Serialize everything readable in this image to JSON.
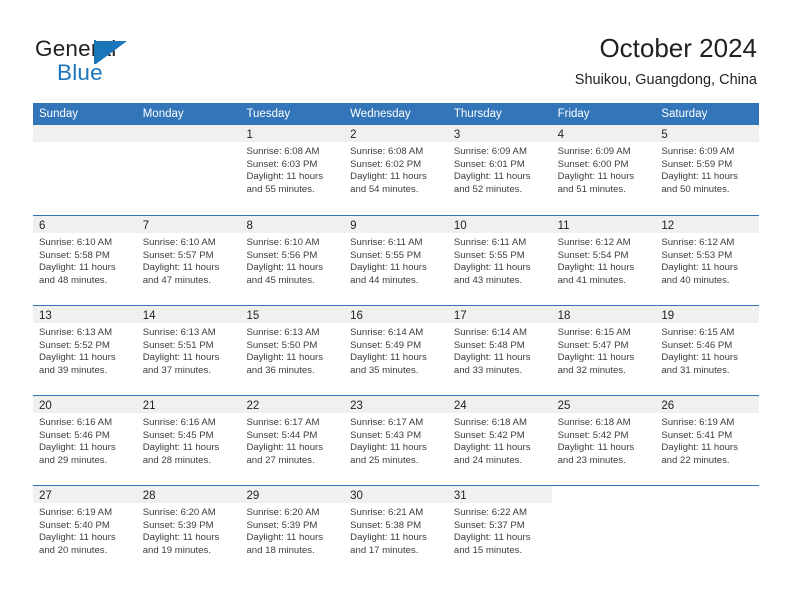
{
  "logo": {
    "word_top": "General",
    "word_bottom": "Blue",
    "accent_color": "#1b75bb"
  },
  "header": {
    "title": "October 2024",
    "subtitle": "Shuikou, Guangdong, China"
  },
  "theme": {
    "header_blue": "#3275b8",
    "day_band_gray": "#f0f0f0",
    "text_color": "#231f20"
  },
  "weekdays": [
    "Sunday",
    "Monday",
    "Tuesday",
    "Wednesday",
    "Thursday",
    "Friday",
    "Saturday"
  ],
  "weeks": [
    [
      {
        "day": "",
        "empty": true
      },
      {
        "day": "",
        "empty": true
      },
      {
        "day": "1",
        "sunrise": "Sunrise: 6:08 AM",
        "sunset": "Sunset: 6:03 PM",
        "daylight1": "Daylight: 11 hours",
        "daylight2": "and 55 minutes."
      },
      {
        "day": "2",
        "sunrise": "Sunrise: 6:08 AM",
        "sunset": "Sunset: 6:02 PM",
        "daylight1": "Daylight: 11 hours",
        "daylight2": "and 54 minutes."
      },
      {
        "day": "3",
        "sunrise": "Sunrise: 6:09 AM",
        "sunset": "Sunset: 6:01 PM",
        "daylight1": "Daylight: 11 hours",
        "daylight2": "and 52 minutes."
      },
      {
        "day": "4",
        "sunrise": "Sunrise: 6:09 AM",
        "sunset": "Sunset: 6:00 PM",
        "daylight1": "Daylight: 11 hours",
        "daylight2": "and 51 minutes."
      },
      {
        "day": "5",
        "sunrise": "Sunrise: 6:09 AM",
        "sunset": "Sunset: 5:59 PM",
        "daylight1": "Daylight: 11 hours",
        "daylight2": "and 50 minutes."
      }
    ],
    [
      {
        "day": "6",
        "sunrise": "Sunrise: 6:10 AM",
        "sunset": "Sunset: 5:58 PM",
        "daylight1": "Daylight: 11 hours",
        "daylight2": "and 48 minutes."
      },
      {
        "day": "7",
        "sunrise": "Sunrise: 6:10 AM",
        "sunset": "Sunset: 5:57 PM",
        "daylight1": "Daylight: 11 hours",
        "daylight2": "and 47 minutes."
      },
      {
        "day": "8",
        "sunrise": "Sunrise: 6:10 AM",
        "sunset": "Sunset: 5:56 PM",
        "daylight1": "Daylight: 11 hours",
        "daylight2": "and 45 minutes."
      },
      {
        "day": "9",
        "sunrise": "Sunrise: 6:11 AM",
        "sunset": "Sunset: 5:55 PM",
        "daylight1": "Daylight: 11 hours",
        "daylight2": "and 44 minutes."
      },
      {
        "day": "10",
        "sunrise": "Sunrise: 6:11 AM",
        "sunset": "Sunset: 5:55 PM",
        "daylight1": "Daylight: 11 hours",
        "daylight2": "and 43 minutes."
      },
      {
        "day": "11",
        "sunrise": "Sunrise: 6:12 AM",
        "sunset": "Sunset: 5:54 PM",
        "daylight1": "Daylight: 11 hours",
        "daylight2": "and 41 minutes."
      },
      {
        "day": "12",
        "sunrise": "Sunrise: 6:12 AM",
        "sunset": "Sunset: 5:53 PM",
        "daylight1": "Daylight: 11 hours",
        "daylight2": "and 40 minutes."
      }
    ],
    [
      {
        "day": "13",
        "sunrise": "Sunrise: 6:13 AM",
        "sunset": "Sunset: 5:52 PM",
        "daylight1": "Daylight: 11 hours",
        "daylight2": "and 39 minutes."
      },
      {
        "day": "14",
        "sunrise": "Sunrise: 6:13 AM",
        "sunset": "Sunset: 5:51 PM",
        "daylight1": "Daylight: 11 hours",
        "daylight2": "and 37 minutes."
      },
      {
        "day": "15",
        "sunrise": "Sunrise: 6:13 AM",
        "sunset": "Sunset: 5:50 PM",
        "daylight1": "Daylight: 11 hours",
        "daylight2": "and 36 minutes."
      },
      {
        "day": "16",
        "sunrise": "Sunrise: 6:14 AM",
        "sunset": "Sunset: 5:49 PM",
        "daylight1": "Daylight: 11 hours",
        "daylight2": "and 35 minutes."
      },
      {
        "day": "17",
        "sunrise": "Sunrise: 6:14 AM",
        "sunset": "Sunset: 5:48 PM",
        "daylight1": "Daylight: 11 hours",
        "daylight2": "and 33 minutes."
      },
      {
        "day": "18",
        "sunrise": "Sunrise: 6:15 AM",
        "sunset": "Sunset: 5:47 PM",
        "daylight1": "Daylight: 11 hours",
        "daylight2": "and 32 minutes."
      },
      {
        "day": "19",
        "sunrise": "Sunrise: 6:15 AM",
        "sunset": "Sunset: 5:46 PM",
        "daylight1": "Daylight: 11 hours",
        "daylight2": "and 31 minutes."
      }
    ],
    [
      {
        "day": "20",
        "sunrise": "Sunrise: 6:16 AM",
        "sunset": "Sunset: 5:46 PM",
        "daylight1": "Daylight: 11 hours",
        "daylight2": "and 29 minutes."
      },
      {
        "day": "21",
        "sunrise": "Sunrise: 6:16 AM",
        "sunset": "Sunset: 5:45 PM",
        "daylight1": "Daylight: 11 hours",
        "daylight2": "and 28 minutes."
      },
      {
        "day": "22",
        "sunrise": "Sunrise: 6:17 AM",
        "sunset": "Sunset: 5:44 PM",
        "daylight1": "Daylight: 11 hours",
        "daylight2": "and 27 minutes."
      },
      {
        "day": "23",
        "sunrise": "Sunrise: 6:17 AM",
        "sunset": "Sunset: 5:43 PM",
        "daylight1": "Daylight: 11 hours",
        "daylight2": "and 25 minutes."
      },
      {
        "day": "24",
        "sunrise": "Sunrise: 6:18 AM",
        "sunset": "Sunset: 5:42 PM",
        "daylight1": "Daylight: 11 hours",
        "daylight2": "and 24 minutes."
      },
      {
        "day": "25",
        "sunrise": "Sunrise: 6:18 AM",
        "sunset": "Sunset: 5:42 PM",
        "daylight1": "Daylight: 11 hours",
        "daylight2": "and 23 minutes."
      },
      {
        "day": "26",
        "sunrise": "Sunrise: 6:19 AM",
        "sunset": "Sunset: 5:41 PM",
        "daylight1": "Daylight: 11 hours",
        "daylight2": "and 22 minutes."
      }
    ],
    [
      {
        "day": "27",
        "sunrise": "Sunrise: 6:19 AM",
        "sunset": "Sunset: 5:40 PM",
        "daylight1": "Daylight: 11 hours",
        "daylight2": "and 20 minutes."
      },
      {
        "day": "28",
        "sunrise": "Sunrise: 6:20 AM",
        "sunset": "Sunset: 5:39 PM",
        "daylight1": "Daylight: 11 hours",
        "daylight2": "and 19 minutes."
      },
      {
        "day": "29",
        "sunrise": "Sunrise: 6:20 AM",
        "sunset": "Sunset: 5:39 PM",
        "daylight1": "Daylight: 11 hours",
        "daylight2": "and 18 minutes."
      },
      {
        "day": "30",
        "sunrise": "Sunrise: 6:21 AM",
        "sunset": "Sunset: 5:38 PM",
        "daylight1": "Daylight: 11 hours",
        "daylight2": "and 17 minutes."
      },
      {
        "day": "31",
        "sunrise": "Sunrise: 6:22 AM",
        "sunset": "Sunset: 5:37 PM",
        "daylight1": "Daylight: 11 hours",
        "daylight2": "and 15 minutes."
      },
      {
        "day": "",
        "empty": true,
        "blank": true
      },
      {
        "day": "",
        "empty": true,
        "blank": true
      }
    ]
  ]
}
